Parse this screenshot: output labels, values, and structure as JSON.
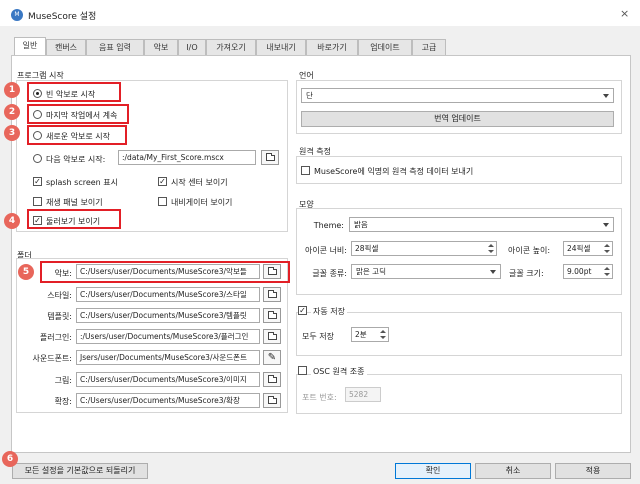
{
  "window": {
    "title": "MuseScore 설정",
    "app_icon_text": "M",
    "close_glyph": "×"
  },
  "tabs": [
    {
      "label": "일반"
    },
    {
      "label": "캔버스"
    },
    {
      "label": "음표 입력"
    },
    {
      "label": "악보"
    },
    {
      "label": "I/O"
    },
    {
      "label": "가져오기"
    },
    {
      "label": "내보내기"
    },
    {
      "label": "바로가기"
    },
    {
      "label": "업데이트"
    },
    {
      "label": "고급"
    }
  ],
  "program_start": {
    "title": "프로그램 시작",
    "option_empty": "빈 악보로 시작",
    "option_last": "마지막 작업에서 계속",
    "option_new": "새로운 악보로 시작",
    "option_score": "다음 악보로 시작:",
    "score_path": ":/data/My_First_Score.mscx",
    "splash": "splash screen 표시",
    "start_center": "시작 센터 보이기",
    "play_panel": "재생 패널 보이기",
    "navigator": "내비게이터 보이기",
    "tours": "둘러보기 보이기"
  },
  "folders": {
    "title": "폴더",
    "rows": [
      {
        "label": "악보:",
        "path": "C:/Users/user/Documents/MuseScore3/악보들"
      },
      {
        "label": "스타일:",
        "path": "C:/Users/user/Documents/MuseScore3/스타일"
      },
      {
        "label": "템플릿:",
        "path": "C:/Users/user/Documents/MuseScore3/템플릿"
      },
      {
        "label": "플러그인:",
        "path": ":/Users/user/Documents/MuseScore3/플러그인"
      },
      {
        "label": "사운드폰트:",
        "path": "Jsers/user/Documents/MuseScore3/사운드폰트"
      },
      {
        "label": "그림:",
        "path": "C:/Users/user/Documents/MuseScore3/이미지"
      },
      {
        "label": "확장:",
        "path": "C:/Users/user/Documents/MuseScore3/확장"
      }
    ]
  },
  "language": {
    "title": "언어",
    "value": "단",
    "update_button": "번역 업데이트"
  },
  "telemetry": {
    "title": "원격 측정",
    "checkbox": "MuseScore에 익명의 원격 측정 데이터 보내기"
  },
  "appearance": {
    "title": "모양",
    "theme_label": "Theme:",
    "theme_value": "밝음",
    "icon_width_label": "아이콘 너비:",
    "icon_width_value": "28픽셀",
    "icon_height_label": "아이콘 높이:",
    "icon_height_value": "24픽셀",
    "font_face_label": "글꼴 종류:",
    "font_face_value": "맑은 고딕",
    "font_size_label": "글꼴 크기:",
    "font_size_value": "9.00pt"
  },
  "autosave": {
    "title": "자동 저장",
    "every_label": "모두 저장",
    "every_value": "2분"
  },
  "osc": {
    "title": "OSC 원격 조종",
    "port_label": "포트 번호:",
    "port_value": "5282"
  },
  "footer": {
    "reset_button": "모든 설정을 기본값으로 되돌리기",
    "ok_button": "확인",
    "cancel_button": "취소",
    "apply_button": "적용"
  },
  "annotations": [
    "1",
    "2",
    "3",
    "4",
    "5",
    "6"
  ],
  "colors": {
    "highlight": "#e21f26",
    "badge": "#e8665b",
    "accent": "#0078d7"
  }
}
